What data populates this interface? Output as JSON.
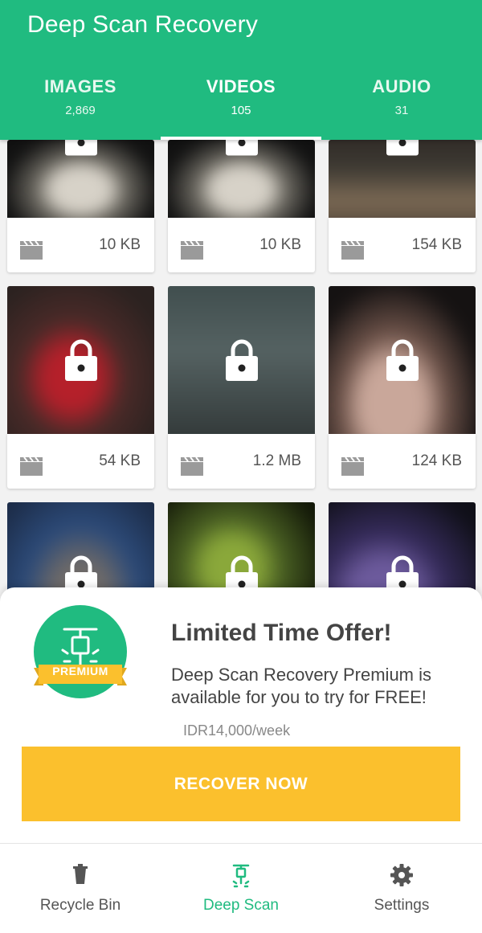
{
  "header": {
    "title": "Deep Scan Recovery",
    "tabs": [
      {
        "label": "IMAGES",
        "count": "2,869"
      },
      {
        "label": "VIDEOS",
        "count": "105",
        "active": true
      },
      {
        "label": "AUDIO",
        "count": "31"
      }
    ]
  },
  "videos": [
    {
      "size": "10 KB",
      "thumb": "radial-gradient(ellipse at 50% 60%, #d7d2c8 0 22%, #6d6a62 35%, #111 62%)"
    },
    {
      "size": "10 KB",
      "thumb": "radial-gradient(ellipse at 50% 60%, #d7d2c8 0 22%, #6d6a62 35%, #111 62%)"
    },
    {
      "size": "154 KB",
      "thumb": "linear-gradient(180deg, #2a2522 0%, #3e3a33 40%, #7c6a55 70%, #4a3f35 100%)"
    },
    {
      "size": "54 KB",
      "thumb": "radial-gradient(ellipse at 45% 60%, #b5202a 0 18%, #4a2a28 38%, #2b2220 70%)"
    },
    {
      "size": "1.2 MB",
      "thumb": "linear-gradient(180deg, #3c4a4a 0%, #556262 45%, #2e3434 100%)"
    },
    {
      "size": "124 KB",
      "thumb": "radial-gradient(ellipse at 45% 75%, #c9a79a 0 22%, #6b5148 38%, #151212 65%)"
    },
    {
      "size": "",
      "thumb": "radial-gradient(ellipse at 50% 60%, #6e6a68 0 20%, #2c4a78 45%, #1c2c48 80%)"
    },
    {
      "size": "",
      "thumb": "radial-gradient(ellipse at 45% 45%, #8aa83a 0 18%, #485e22 36%, #121708 70%)"
    },
    {
      "size": "",
      "thumb": "radial-gradient(ellipse at 40% 60%, #6c5a9c 0 20%, #352b5a 40%, #0f0f17 75%)"
    }
  ],
  "offer": {
    "badge": "PREMIUM",
    "title": "Limited Time Offer!",
    "text": "Deep Scan Recovery Premium is available for you to try for FREE!",
    "price": "IDR14,000/week",
    "button": "RECOVER NOW"
  },
  "bottom_nav": [
    {
      "label": "Recycle Bin",
      "icon": "trash-icon"
    },
    {
      "label": "Deep Scan",
      "icon": "jackhammer-icon",
      "active": true
    },
    {
      "label": "Settings",
      "icon": "gear-icon"
    }
  ],
  "colors": {
    "primary": "#20bb80",
    "accent": "#fbc02d",
    "text": "#444444"
  }
}
